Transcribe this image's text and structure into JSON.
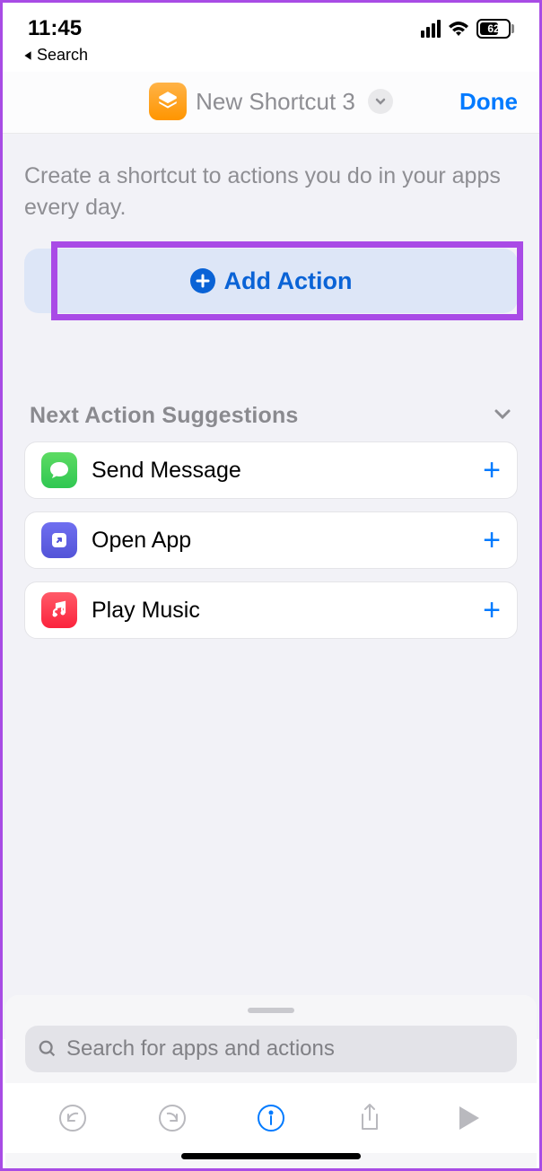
{
  "status": {
    "time": "11:45",
    "battery": "62"
  },
  "back": {
    "label": "Search"
  },
  "header": {
    "title": "New Shortcut 3",
    "done": "Done"
  },
  "main": {
    "intro": "Create a shortcut to actions you do in your apps every day.",
    "add_action": "Add Action",
    "suggestions_title": "Next Action Suggestions",
    "suggestions": [
      {
        "label": "Send Message",
        "icon": "message-icon",
        "color": "green"
      },
      {
        "label": "Open App",
        "icon": "open-app-icon",
        "color": "purple"
      },
      {
        "label": "Play Music",
        "icon": "music-icon",
        "color": "red"
      }
    ]
  },
  "search": {
    "placeholder": "Search for apps and actions"
  }
}
